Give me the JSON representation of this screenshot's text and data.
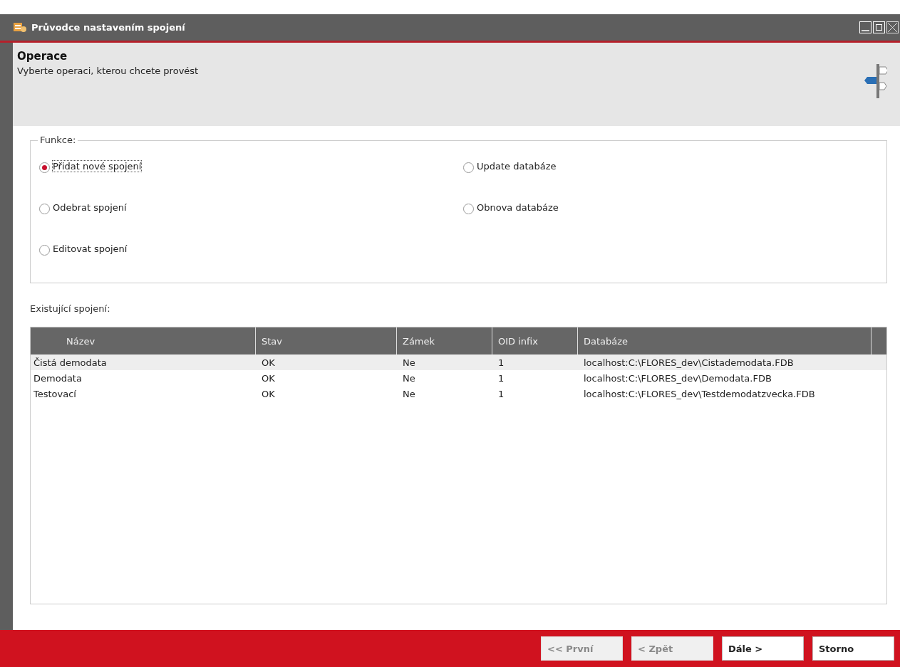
{
  "window": {
    "title": "Průvodce nastavením spojení"
  },
  "header": {
    "title": "Operace",
    "subtitle": "Vyberte operaci, kterou chcete provést"
  },
  "functions": {
    "label": "Funkce:",
    "options": [
      {
        "label": "Přidat nové spojení",
        "selected": true
      },
      {
        "label": "Odebrat spojení",
        "selected": false
      },
      {
        "label": "Editovat spojení",
        "selected": false
      },
      {
        "label": "Update databáze",
        "selected": false
      },
      {
        "label": "Obnova databáze",
        "selected": false
      }
    ]
  },
  "connections": {
    "label": "Existující spojení:",
    "columns": [
      "Název",
      "Stav",
      "Zámek",
      "OID infix",
      "Databáze"
    ],
    "rows": [
      {
        "cells": [
          "Čistá demodata",
          "OK",
          "Ne",
          "1",
          "localhost:C:\\FLORES_dev\\Cistademodata.FDB"
        ],
        "selected": true
      },
      {
        "cells": [
          "Demodata",
          "OK",
          "Ne",
          "1",
          "localhost:C:\\FLORES_dev\\Demodata.FDB"
        ],
        "selected": false
      },
      {
        "cells": [
          "Testovací",
          "OK",
          "Ne",
          "1",
          "localhost:C:\\FLORES_dev\\Testdemodatzvecka.FDB"
        ],
        "selected": false
      }
    ]
  },
  "buttons": [
    {
      "label": "<< První",
      "disabled": true
    },
    {
      "label": "< Zpět",
      "disabled": true
    },
    {
      "label": "Dále >",
      "disabled": false
    },
    {
      "label": "Storno",
      "disabled": false
    }
  ]
}
